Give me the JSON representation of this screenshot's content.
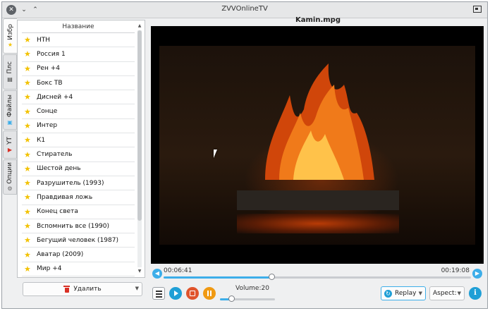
{
  "window": {
    "title": "ZVVOnlineTV"
  },
  "tabs": [
    {
      "label": "Избр",
      "icon": "star-icon",
      "active": true
    },
    {
      "label": "Плс",
      "icon": "playlist-icon",
      "active": false
    },
    {
      "label": "Файлы",
      "icon": "file-icon",
      "active": false
    },
    {
      "label": "YT",
      "icon": "youtube-icon",
      "active": false
    },
    {
      "label": "Опции",
      "icon": "options-icon",
      "active": false
    }
  ],
  "channels": {
    "header": "Название",
    "items": [
      "НТН",
      "Россия 1",
      "Рен +4",
      "Бокс ТВ",
      "Дисней +4",
      "Сонце",
      "Интер",
      "К1",
      "Стиратель",
      "Шестой день",
      "Разрушитель (1993)",
      "Правдивая ложь",
      "Конец света",
      "Вспомнить все (1990)",
      "Бегущий человек (1987)",
      "Аватар (2009)",
      "Мир +4"
    ]
  },
  "delete_button": {
    "label": "Удалить"
  },
  "player": {
    "file_title": "Kamin.mpg",
    "current_time": "00:06:41",
    "total_time": "00:19:08",
    "progress": 0.35,
    "volume_label": "Volume:20",
    "volume": 0.2,
    "replay_label": "Replay",
    "aspect_label": "Aspect:"
  },
  "colors": {
    "accent": "#3daee9",
    "play": "#1f9fd6",
    "stop": "#e0542c",
    "pause": "#f09a13",
    "star": "#f2c200"
  }
}
